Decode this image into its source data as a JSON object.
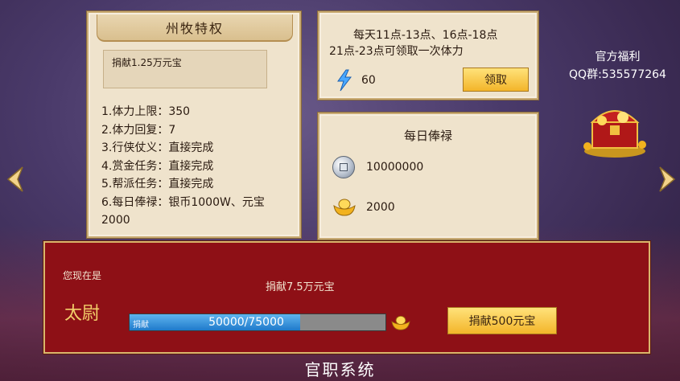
{
  "privilege_card": {
    "title": "州牧特权",
    "donate_cost": "捐献1.25万元宝",
    "perks": [
      "1.体力上限：350",
      "2.体力回复：7",
      "3.行侠仗义：直接完成",
      "4.赏金任务：直接完成",
      "5.帮派任务：直接完成",
      "6.每日俸禄：银币1000W、元宝",
      "2000"
    ]
  },
  "stamina_card": {
    "line1": "每天11点-13点、16点-18点",
    "line2": "21点-23点可领取一次体力",
    "amount": "60",
    "claim_label": "领取"
  },
  "salary_card": {
    "title": "每日俸禄",
    "silver": "10000000",
    "gold": "2000"
  },
  "welfare": {
    "title": "官方福利",
    "qq": "QQ群:535577264"
  },
  "rank_panel": {
    "current_label": "您现在是",
    "rank": "太尉",
    "donate_requirement": "捐献7.5万元宝",
    "progress_label": "捐献",
    "progress_text": "50000/75000",
    "progress_fraction": 0.667,
    "donate_button": "捐献500元宝"
  },
  "page_title": "官职系统",
  "colors": {
    "panel_bg": "#efe3cc",
    "panel_border": "#c9ab74",
    "button_gold": "#f3b52a",
    "rank_panel_bg": "#8e1016",
    "progress_blue": "#1f7acb"
  },
  "icons": [
    "lightning-icon",
    "silver-coin-icon",
    "gold-ingot-icon",
    "treasure-chest-icon",
    "left-arrow-icon",
    "right-arrow-icon"
  ]
}
